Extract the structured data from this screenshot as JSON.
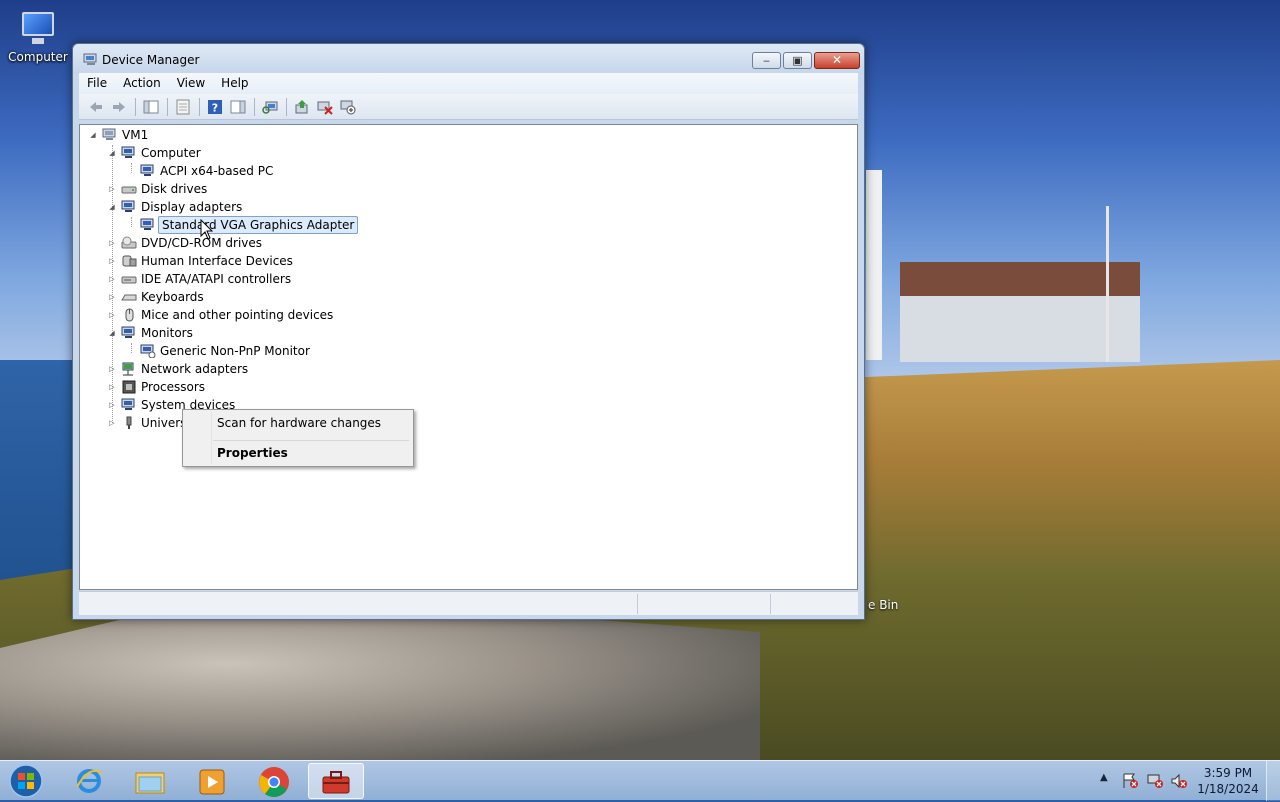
{
  "desktop": {
    "icons": [
      {
        "label": "Computer"
      }
    ],
    "recycle_bin_partial_label": "e Bin"
  },
  "window": {
    "title": "Device Manager",
    "menu": [
      "File",
      "Action",
      "View",
      "Help"
    ],
    "toolbar_icons": [
      "back-icon",
      "forward-icon",
      "properties-view-icon",
      "console-tree-icon",
      "help-icon",
      "action-pane-icon",
      "scan-hardware-icon",
      "update-driver-icon",
      "uninstall-icon",
      "disable-device-icon"
    ]
  },
  "tree": {
    "root": "VM1",
    "items": [
      {
        "label": "Computer",
        "expanded": true
      },
      {
        "label": "ACPI x64-based PC"
      },
      {
        "label": "Disk drives",
        "expanded": false
      },
      {
        "label": "Display adapters",
        "expanded": true
      },
      {
        "label": "Standard VGA Graphics Adapter",
        "selected": true
      },
      {
        "label": "DVD/CD-ROM drives",
        "expanded": false
      },
      {
        "label": "Human Interface Devices",
        "expanded": false
      },
      {
        "label": "IDE ATA/ATAPI controllers",
        "expanded": false
      },
      {
        "label": "Keyboards",
        "expanded": false
      },
      {
        "label": "Mice and other pointing devices",
        "expanded": false
      },
      {
        "label": "Monitors",
        "expanded": true
      },
      {
        "label": "Generic Non-PnP Monitor"
      },
      {
        "label": "Network adapters",
        "expanded": false
      },
      {
        "label": "Processors",
        "expanded": false
      },
      {
        "label": "System devices",
        "expanded": false
      },
      {
        "label": "Univers",
        "expanded": false
      }
    ]
  },
  "context_menu": {
    "items": [
      {
        "label": "Scan for hardware changes"
      },
      {
        "label": "Properties",
        "bold": true
      }
    ]
  },
  "taskbar": {
    "apps": [
      "start-orb-icon",
      "internet-explorer-icon",
      "file-explorer-icon",
      "media-player-icon",
      "chrome-icon",
      "toolbox-icon"
    ],
    "clock_time": "3:59 PM",
    "clock_date": "1/18/2024"
  },
  "colors": {
    "selection_bg": "#dcebfc",
    "selection_border": "#7da2ce",
    "titlebar": "#c5d6ea",
    "close_button": "#c7402c"
  }
}
